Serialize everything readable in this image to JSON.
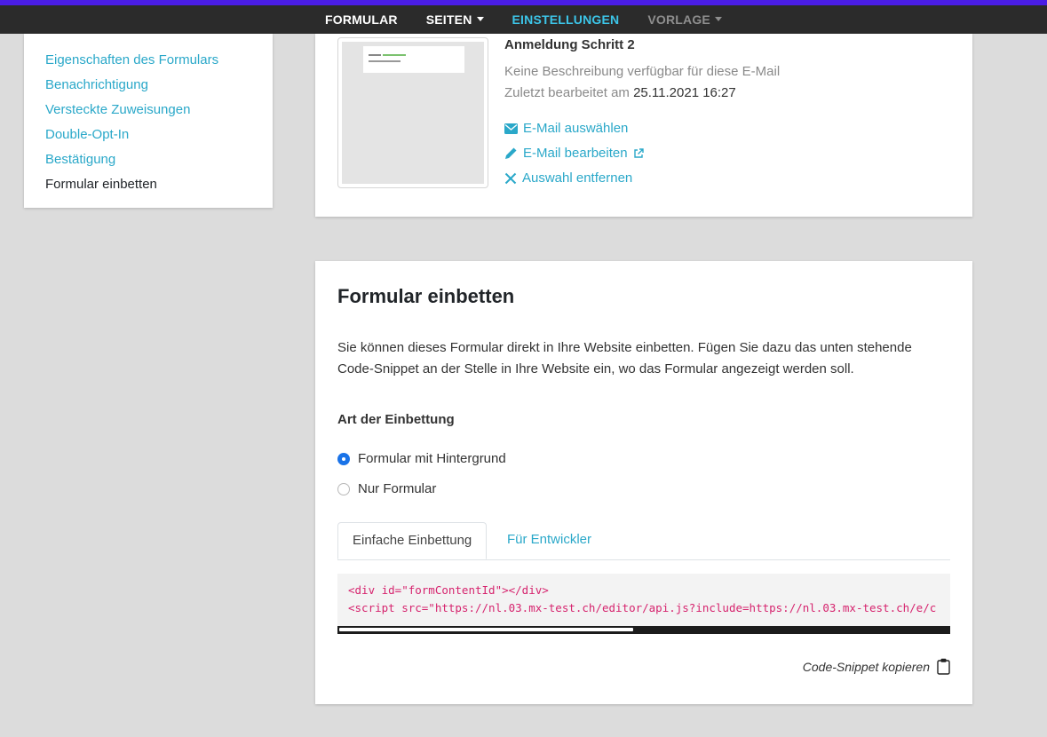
{
  "topnav": {
    "items": [
      {
        "label": "FORMULAR",
        "dropdown": false,
        "state": "normal"
      },
      {
        "label": "SEITEN",
        "dropdown": true,
        "state": "normal"
      },
      {
        "label": "EINSTELLUNGEN",
        "dropdown": false,
        "state": "active"
      },
      {
        "label": "VORLAGE",
        "dropdown": true,
        "state": "disabled"
      }
    ]
  },
  "sidebar": {
    "items": [
      {
        "label": "Eigenschaften des Formulars"
      },
      {
        "label": "Benachrichtigung"
      },
      {
        "label": "Versteckte Zuweisungen"
      },
      {
        "label": "Double-Opt-In"
      },
      {
        "label": "Bestätigung"
      },
      {
        "label": "Formular einbetten",
        "current": true
      }
    ]
  },
  "email_card": {
    "title": "Anmeldung Schritt 2",
    "description": "Keine Beschreibung verfügbar für diese E-Mail",
    "edited_prefix": "Zuletzt bearbeitet am",
    "edited_date": "25.11.2021 16:27",
    "actions": {
      "select": "E-Mail auswählen",
      "edit": "E-Mail bearbeiten",
      "remove": "Auswahl entfernen"
    }
  },
  "embed_card": {
    "title": "Formular einbetten",
    "description": "Sie können dieses Formular direkt in Ihre Website einbetten. Fügen Sie dazu das unten stehende Code-Snippet an der Stelle in Ihre Website ein, wo das Formular angezeigt werden soll.",
    "subtitle": "Art der Einbettung",
    "options": [
      {
        "label": "Formular mit Hintergrund",
        "selected": true
      },
      {
        "label": "Nur Formular",
        "selected": false
      }
    ],
    "tabs": {
      "simple": "Einfache Einbettung",
      "developer": "Für Entwickler"
    },
    "code": {
      "line1": "<div id=\"formContentId\"></div>",
      "line2": "<script src=\"https://nl.03.mx-test.ch/editor/api.js?include=https://nl.03.mx-test.ch/e/c"
    },
    "scroll_position": 0.48,
    "copy_label": "Code-Snippet kopieren"
  },
  "colors": {
    "accent_bar": "#4a1de6",
    "link": "#2aa8c9",
    "nav_active": "#3cc5e8",
    "radio_selected": "#1a73e8",
    "code_text": "#d6246e"
  }
}
